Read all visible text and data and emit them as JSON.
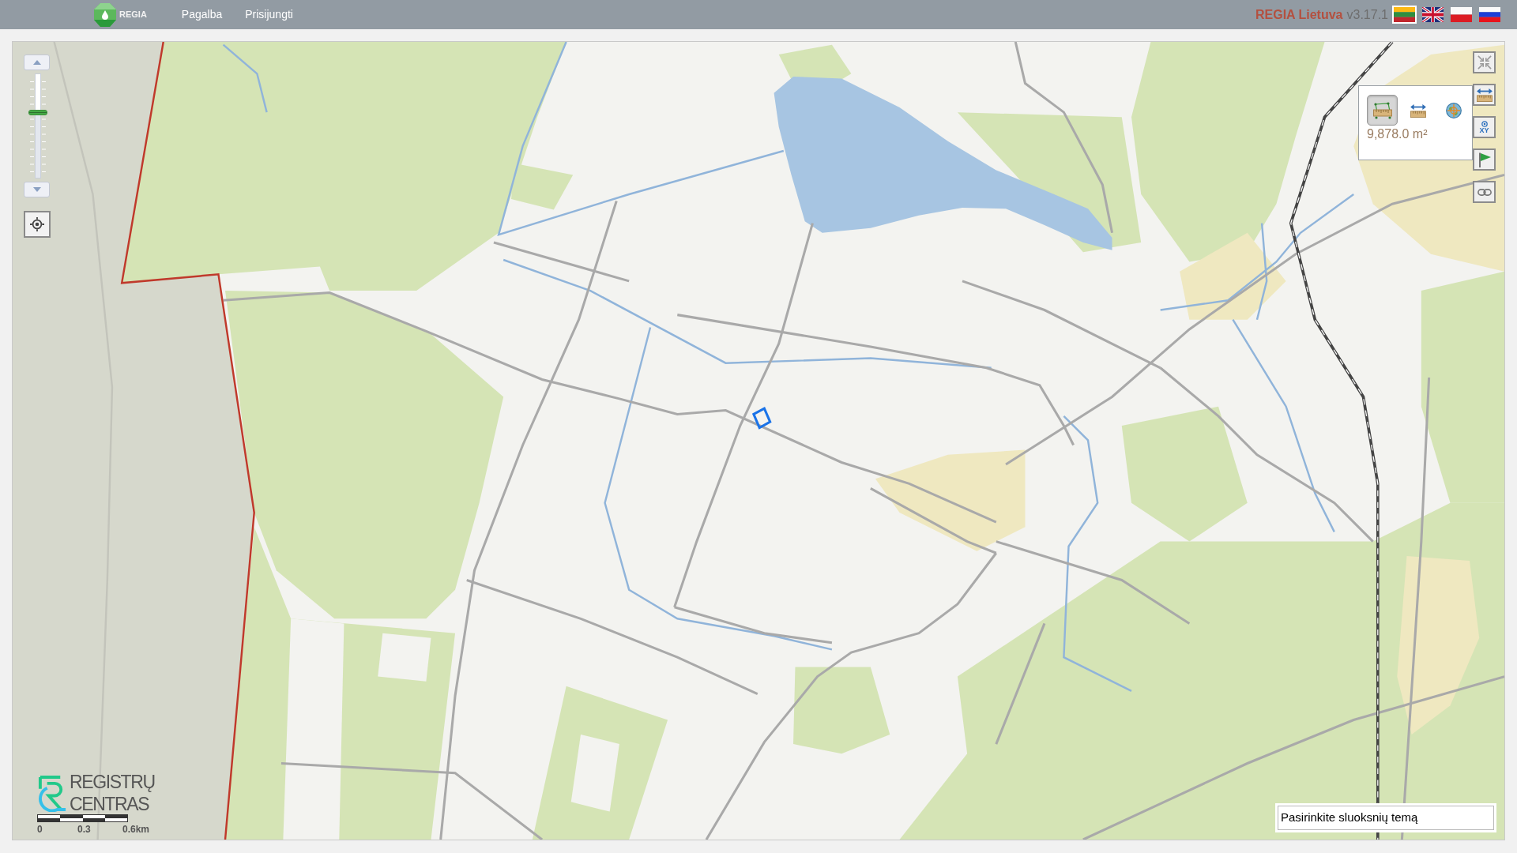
{
  "header": {
    "logo_text": "REGIA",
    "links": [
      "Pagalba",
      "Prisijungti"
    ],
    "title": "REGIA Lietuva",
    "version": "v3.17.1",
    "languages": [
      {
        "selected": true
      },
      {
        "selected": false
      },
      {
        "selected": false
      },
      {
        "selected": false
      }
    ]
  },
  "zoom_slider": {
    "level": 0.63
  },
  "map_tools": [
    {
      "kind": "collapse"
    },
    {
      "kind": "measure"
    },
    {
      "kind": "coordinates",
      "label": "XY"
    },
    {
      "kind": "flag"
    },
    {
      "kind": "link"
    }
  ],
  "measure_popup": {
    "tools": [
      {
        "kind": "area",
        "selected": true
      },
      {
        "kind": "distance",
        "selected": false
      },
      {
        "kind": "coordinate",
        "selected": false
      }
    ],
    "result": "9,878.0 m²"
  },
  "logo": {
    "lines": [
      "REGISTRŲ",
      "CENTRAS"
    ]
  },
  "scale_bar": {
    "labels": [
      "0",
      "0.3",
      "0.6km"
    ]
  },
  "theme_select": {
    "value": "Pasirinkite sluoksnių temą"
  }
}
